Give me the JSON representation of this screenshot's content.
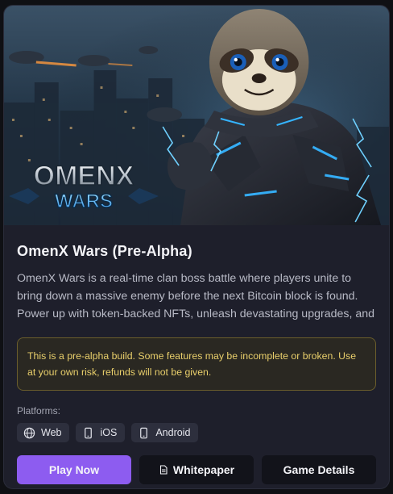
{
  "game": {
    "logo_line1": "OMENX",
    "logo_line2": "WARS",
    "title": "OmenX Wars (Pre-Alpha)",
    "description": "OmenX Wars is a real-time clan boss battle where players unite to bring down a massive enemy before the next Bitcoin block is found. Power up with token-backed NFTs, unleash devastating upgrades, and compete..."
  },
  "warning": {
    "text": "This is a pre-alpha build. Some features may be incomplete or broken. Use at your own risk, refunds will not be given."
  },
  "platforms": {
    "label": "Platforms:",
    "items": [
      {
        "label": "Web",
        "icon": "globe-icon"
      },
      {
        "label": "iOS",
        "icon": "phone-icon"
      },
      {
        "label": "Android",
        "icon": "phone-icon"
      }
    ]
  },
  "actions": {
    "play": "Play Now",
    "whitepaper": "Whitepaper",
    "details": "Game Details"
  },
  "colors": {
    "primary": "#8d5cf0",
    "warning_text": "#e9cf6b",
    "warning_border": "#6a5d2c",
    "card_bg": "#1e1f2b"
  }
}
